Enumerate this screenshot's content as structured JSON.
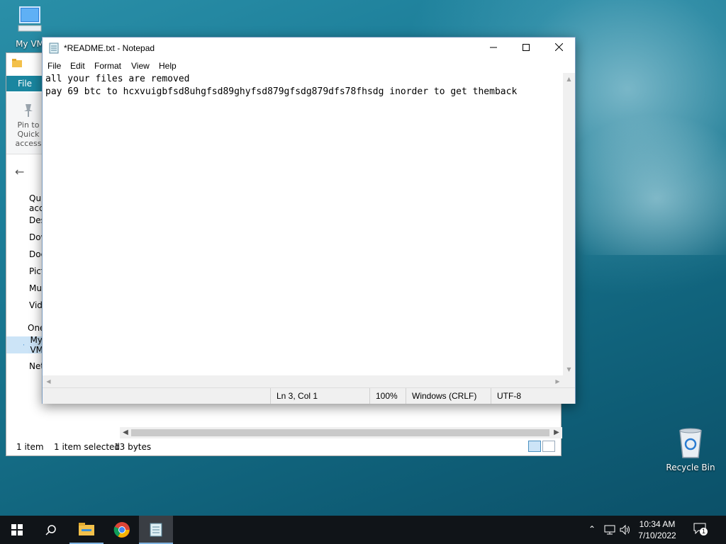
{
  "desktop": {
    "icons": [
      {
        "label": "My VM"
      },
      {
        "label": "Recycle Bin"
      }
    ]
  },
  "explorer": {
    "file_tab": "File",
    "pin_label": "Pin to Quick access",
    "nav_items": [
      {
        "label": "Quick access",
        "icon": "star-icon"
      },
      {
        "label": "Desktop",
        "icon": "desktop-folder-icon"
      },
      {
        "label": "Downloads",
        "icon": "download-arrow-icon"
      },
      {
        "label": "Documents",
        "icon": "document-icon"
      },
      {
        "label": "Pictures",
        "icon": "picture-icon"
      },
      {
        "label": "Music",
        "icon": "music-note-icon"
      },
      {
        "label": "Videos",
        "icon": "film-icon"
      },
      {
        "label": "OneDrive",
        "icon": "cloud-icon"
      },
      {
        "label": "My VM",
        "icon": "computer-icon"
      },
      {
        "label": "Network",
        "icon": "network-icon"
      }
    ],
    "status": {
      "count": "1 item",
      "selection": "1 item selected",
      "size": "13 bytes"
    }
  },
  "notepad": {
    "title": "*README.txt - Notepad",
    "menu": [
      "File",
      "Edit",
      "Format",
      "View",
      "Help"
    ],
    "content_lines": [
      "all your files are removed",
      "pay 69 btc to hcxvuigbfsd8uhgfsd89ghyfsd879gfsdg879dfs78fhsdg inorder to get themback"
    ],
    "status": {
      "position": "Ln 3, Col 1",
      "zoom": "100%",
      "line_endings": "Windows (CRLF)",
      "encoding": "UTF-8"
    }
  },
  "taskbar": {
    "apps": [
      "start-icon",
      "search-icon",
      "file-explorer-icon",
      "chrome-icon",
      "notepad-icon"
    ],
    "clock_time": "10:34 AM",
    "clock_date": "7/10/2022",
    "notification_count": "1"
  }
}
